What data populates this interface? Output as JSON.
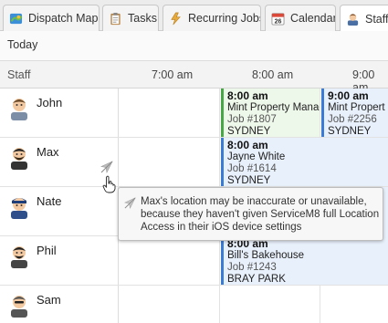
{
  "tabs": [
    {
      "label": "Dispatch Map",
      "icon": "map-icon"
    },
    {
      "label": "Tasks",
      "icon": "clipboard-icon"
    },
    {
      "label": "Recurring Jobs",
      "icon": "recurring-icon"
    },
    {
      "label": "Calendar",
      "icon": "calendar-icon",
      "badge": "26"
    },
    {
      "label": "Staff",
      "icon": "staff-avatar-icon",
      "active": true
    }
  ],
  "toolbar": {
    "today_label": "Today"
  },
  "grid": {
    "staff_header": "Staff",
    "times": [
      "7:00 am",
      "8:00 am",
      "9:00 am"
    ]
  },
  "staff": [
    {
      "name": "John"
    },
    {
      "name": "Max"
    },
    {
      "name": "Nate"
    },
    {
      "name": "Phil"
    },
    {
      "name": "Sam"
    }
  ],
  "jobs": [
    {
      "time": "8:00 am",
      "title": "Mint Property Manag",
      "job": "Job #1807",
      "place": "SYDNEY",
      "color": "#45a845",
      "bg": "#eef8ea"
    },
    {
      "time": "9:00 am",
      "title": "Mint Propert",
      "job": "Job #2256",
      "place": "SYDNEY",
      "color": "#3a7bd5",
      "bg": "#e8f0fb"
    },
    {
      "time": "8:00 am",
      "title": "Jayne White",
      "job": "Job #1614",
      "place": "SYDNEY",
      "color": "#3a7bd5",
      "bg": "#e8f0fb"
    },
    {
      "time": "8:00 am",
      "title": "Bill's Bakehouse",
      "job": "Job #1243",
      "place": "BRAY PARK",
      "color": "#3a7bd5",
      "bg": "#e8f0fb"
    }
  ],
  "tooltip": {
    "text": "Max's location may be inaccurate or unavailable, because they haven't given ServiceM8 full Location Access in their iOS device settings"
  },
  "colors": {
    "accent_blue": "#3a7bd5",
    "accent_green": "#45a845"
  }
}
